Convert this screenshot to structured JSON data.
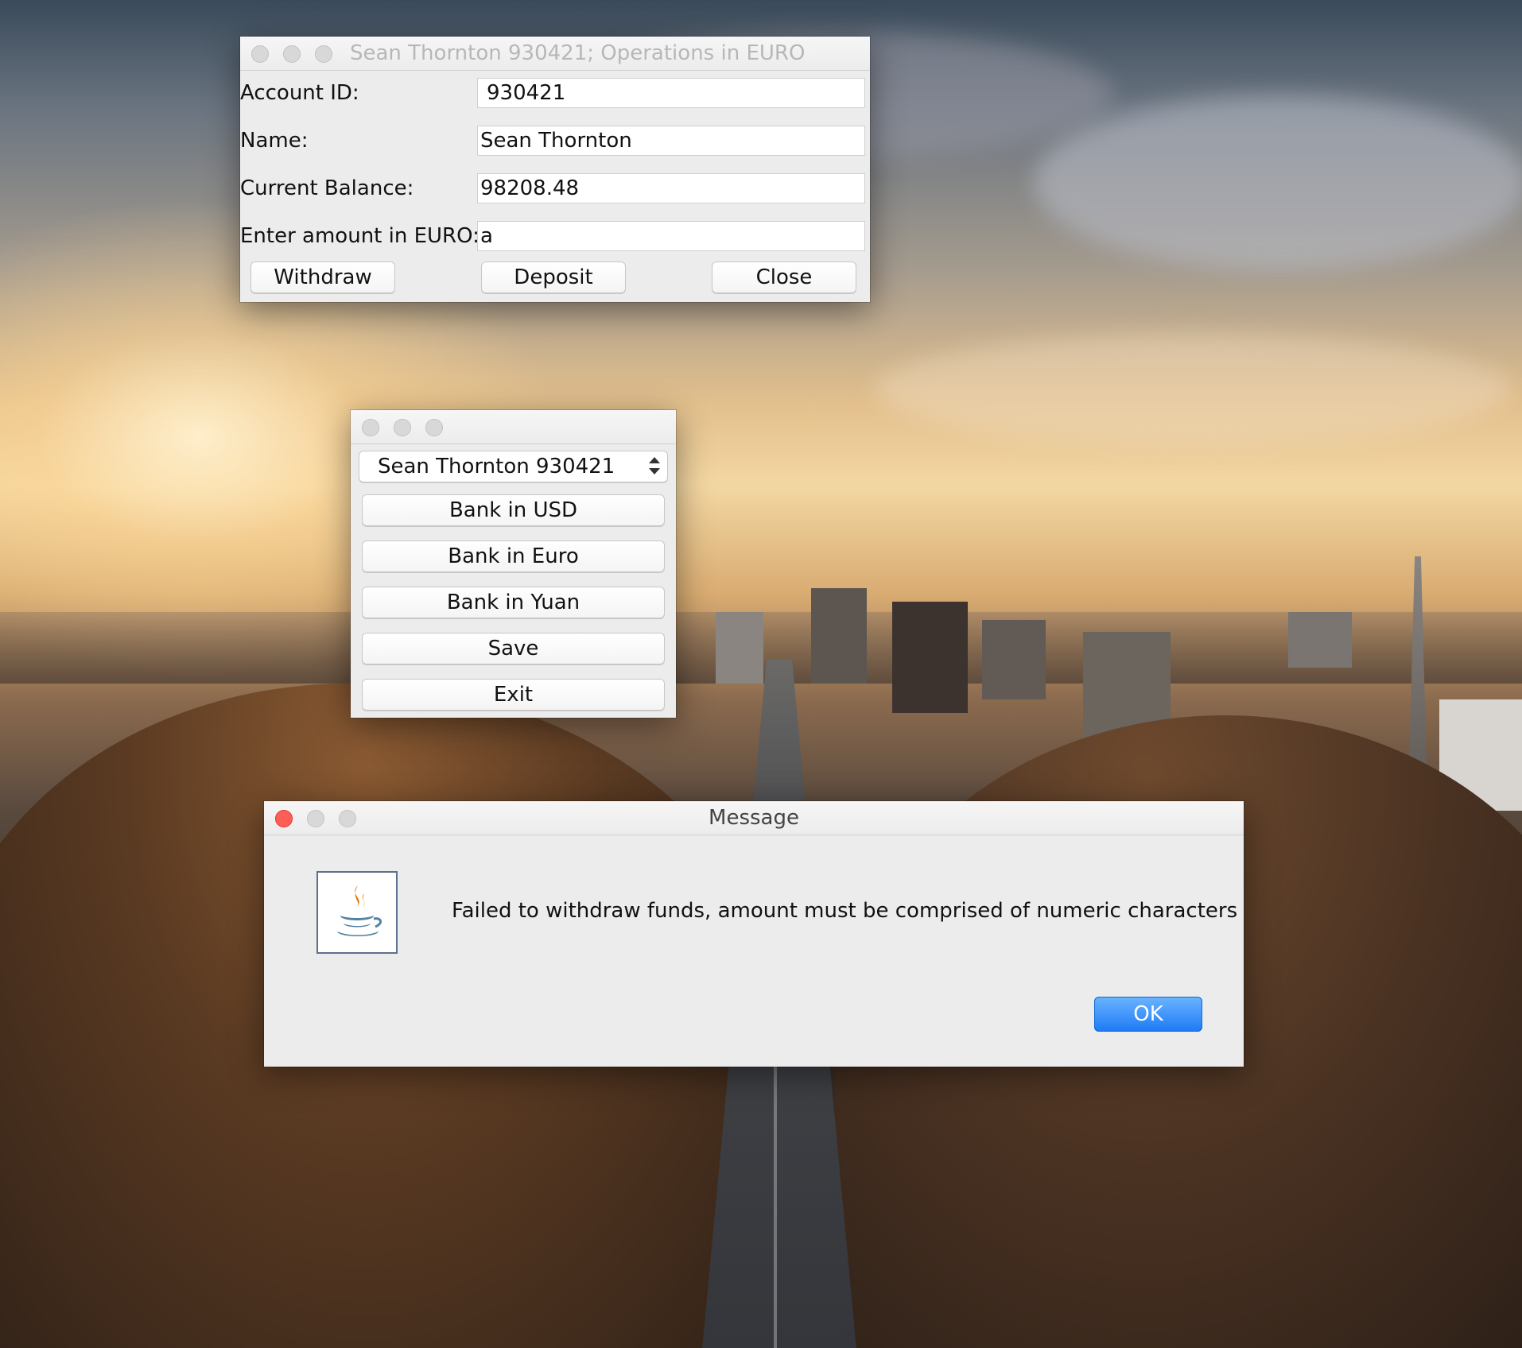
{
  "desktop": {
    "wallpaper": "city-at-sunset"
  },
  "account_window": {
    "title": "Sean Thornton  930421; Operations in EURO",
    "fields": [
      {
        "label": "Account ID:",
        "value": "930421"
      },
      {
        "label": "Name:",
        "value": "Sean Thornton"
      },
      {
        "label": "Current Balance:",
        "value": "98208.48"
      },
      {
        "label": "Enter amount in EURO:",
        "value": "a"
      }
    ],
    "buttons": {
      "withdraw": "Withdraw",
      "deposit": "Deposit",
      "close": "Close"
    }
  },
  "menu_window": {
    "account_select": "Sean Thornton  930421",
    "buttons": [
      "Bank in USD",
      "Bank in Euro",
      "Bank in Yuan",
      "Save",
      "Exit"
    ]
  },
  "message_dialog": {
    "title": "Message",
    "icon": "java-icon",
    "text": "Failed to withdraw funds, amount must be comprised of numeric characters",
    "ok_label": "OK",
    "accent_color": "#1d7af5"
  }
}
